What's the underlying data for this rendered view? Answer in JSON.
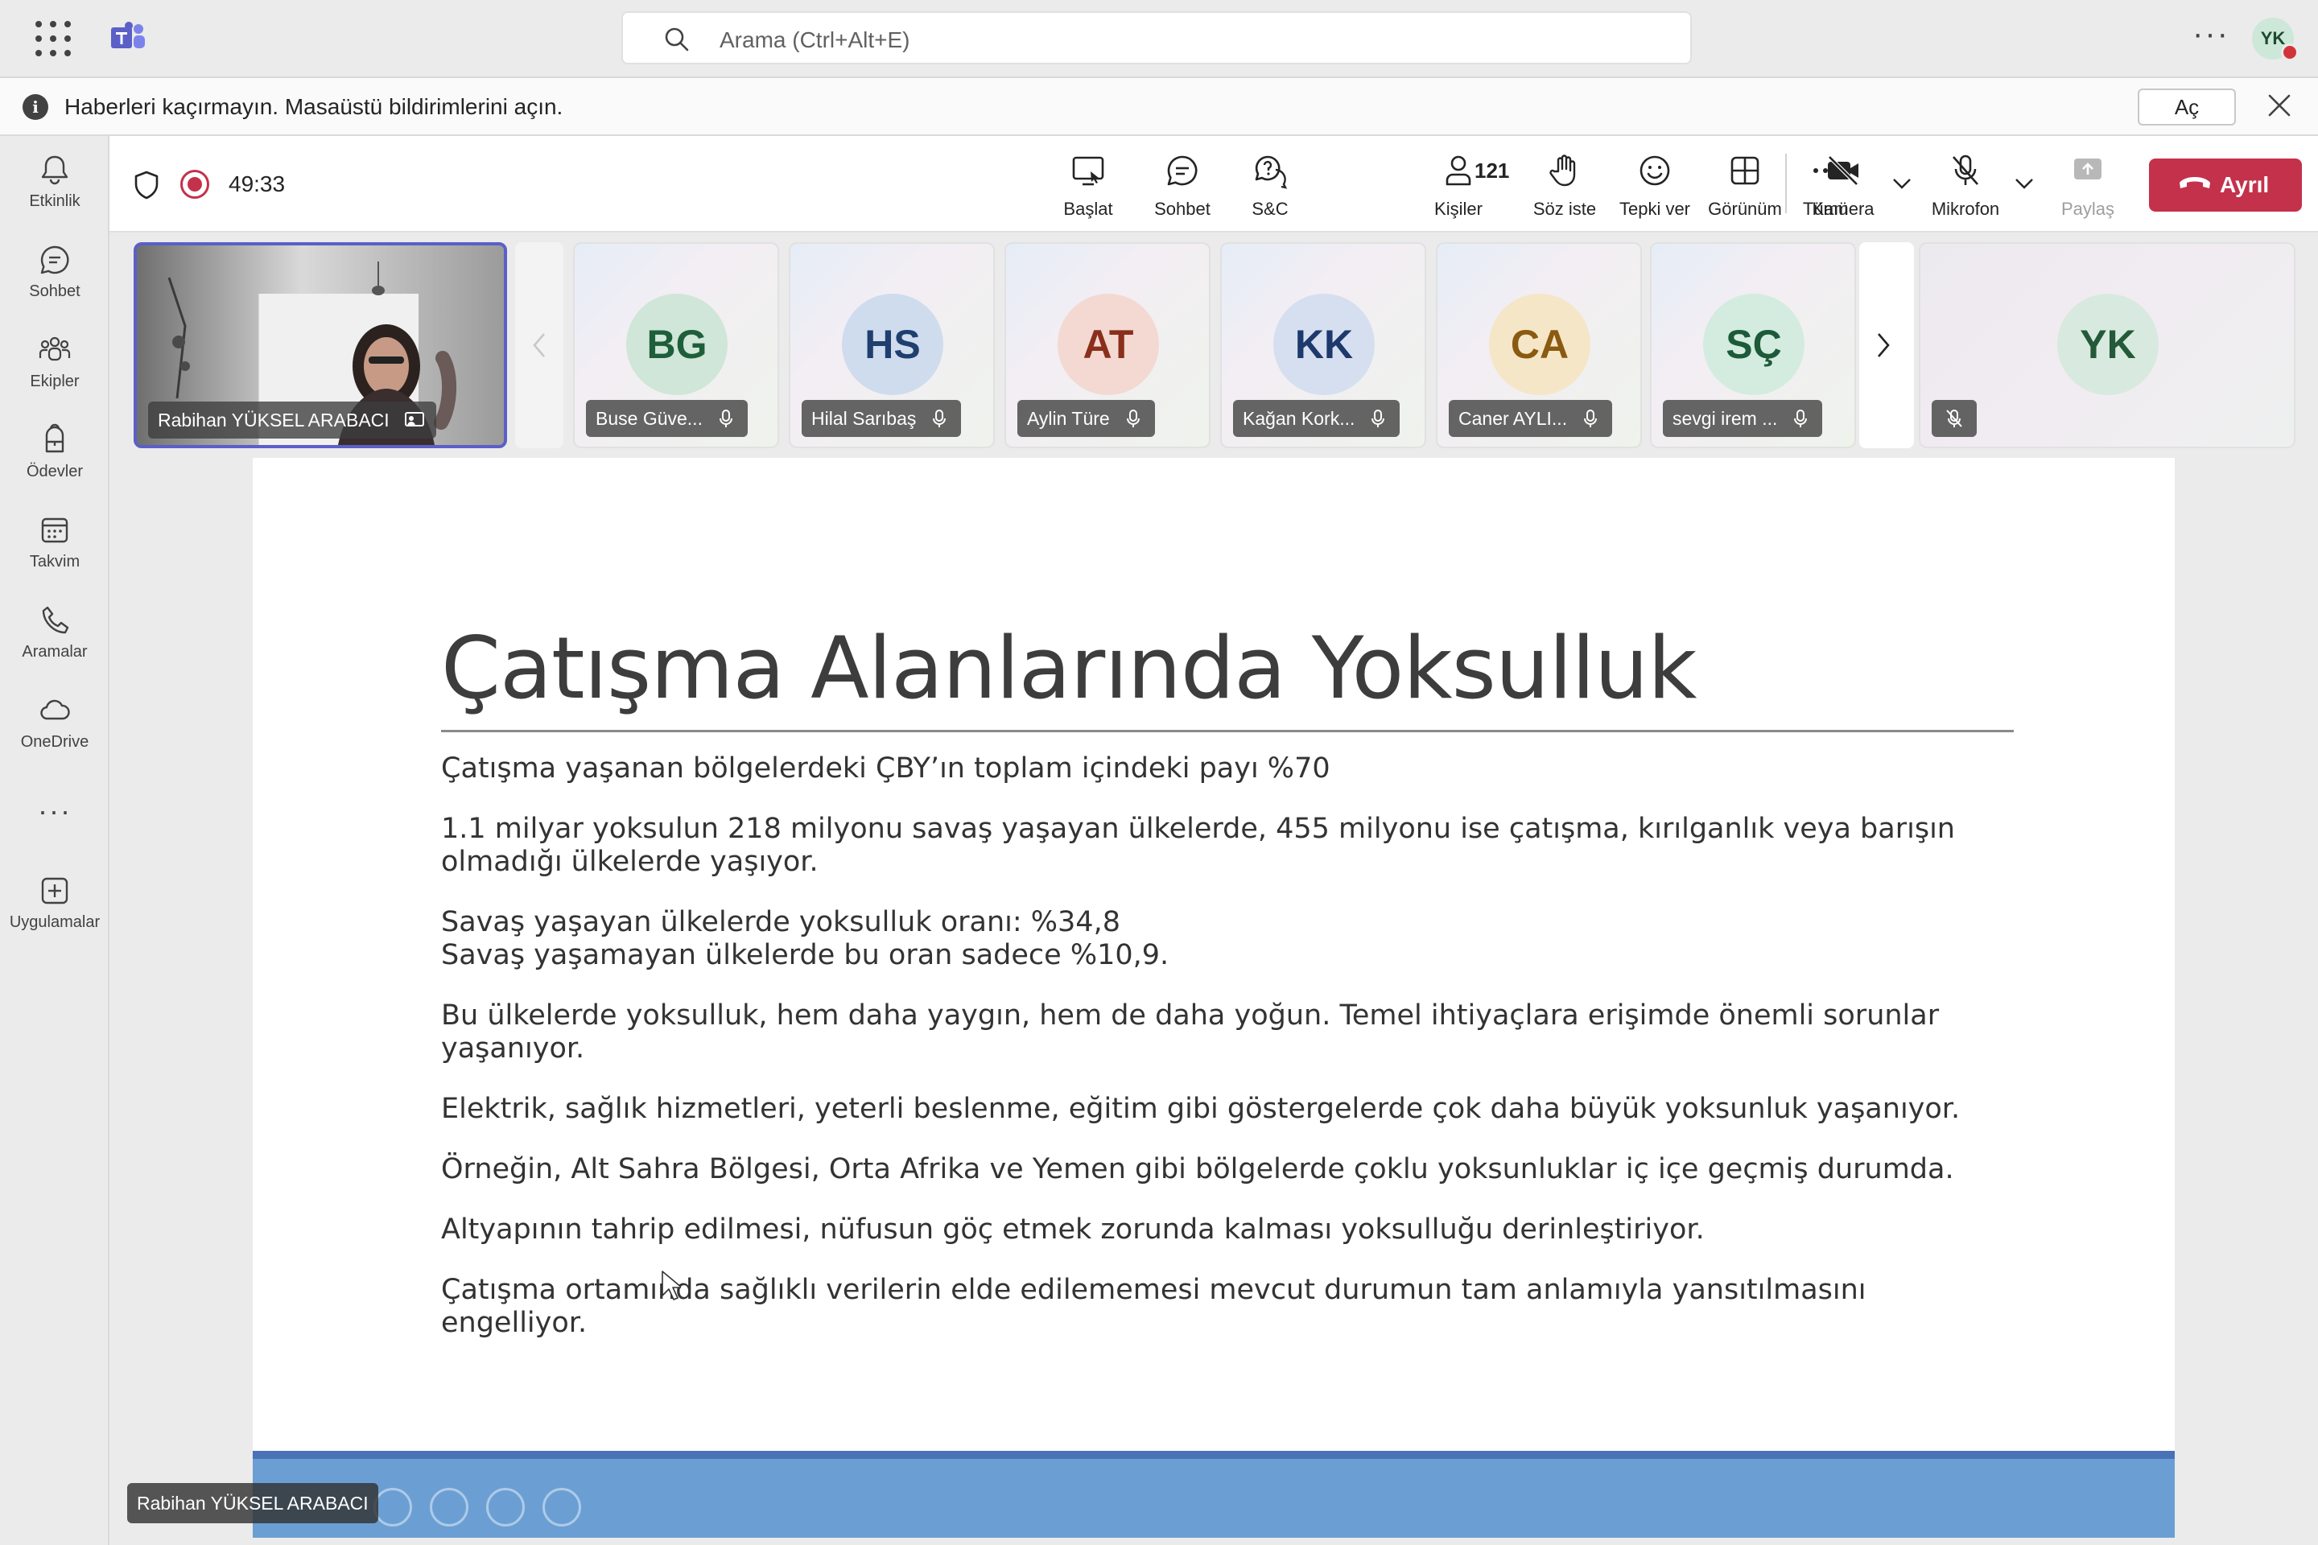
{
  "titlebar": {
    "search_placeholder": "Arama (Ctrl+Alt+E)",
    "user_initials": "YK"
  },
  "notification": {
    "icon_glyph": "i",
    "text": "Haberleri kaçırmayın. Masaüstü bildirimlerini açın.",
    "open_label": "Aç"
  },
  "rail": {
    "items": [
      {
        "label": "Etkinlik",
        "icon": "bell-icon"
      },
      {
        "label": "Sohbet",
        "icon": "chat-icon"
      },
      {
        "label": "Ekipler",
        "icon": "teams-icon"
      },
      {
        "label": "Ödevler",
        "icon": "backpack-icon"
      },
      {
        "label": "Takvim",
        "icon": "calendar-icon"
      },
      {
        "label": "Aramalar",
        "icon": "phone-icon"
      },
      {
        "label": "OneDrive",
        "icon": "cloud-icon"
      }
    ],
    "more": "···",
    "apps_label": "Uygulamalar"
  },
  "meeting": {
    "timer": "49:33",
    "buttons": {
      "start": "Başlat",
      "chat": "Sohbet",
      "qa": "S&C",
      "people": "Kişiler",
      "people_count": "121",
      "raise_hand": "Söz iste",
      "react": "Tepki ver",
      "view": "Görünüm",
      "more": "Tümü",
      "camera": "Kamera",
      "mic": "Mikrofon",
      "share": "Paylaş",
      "leave": "Ayrıl"
    }
  },
  "participants": {
    "presenter": "Rabihan YÜKSEL ARABACI",
    "tiles": [
      {
        "initials": "BG",
        "name": "Buse Güve...",
        "bg": "#cfe6d9",
        "fg": "#1f5e3a"
      },
      {
        "initials": "HS",
        "name": "Hilal Sarıbaş",
        "bg": "#cfdcee",
        "fg": "#1f3f6e"
      },
      {
        "initials": "AT",
        "name": "Aylin Türe",
        "bg": "#f3d9d2",
        "fg": "#8a2f1c"
      },
      {
        "initials": "KK",
        "name": "Kağan Kork...",
        "bg": "#d6dff0",
        "fg": "#1e3a6c"
      },
      {
        "initials": "CA",
        "name": "Caner AYLI...",
        "bg": "#f5e6c8",
        "fg": "#8a5a10"
      },
      {
        "initials": "SÇ",
        "name": "sevgi irem ...",
        "bg": "#d3ecdf",
        "fg": "#1d5a3a"
      }
    ],
    "self_initials": "YK"
  },
  "slide": {
    "title": "Çatışma Alanlarında Yoksulluk",
    "paragraphs": [
      "Çatışma yaşanan bölgelerdeki ÇBY’ın toplam içindeki payı %70",
      "1.1 milyar yoksulun 218 milyonu savaş yaşayan ülkelerde, 455 milyonu ise çatışma, kırılganlık veya barışın olmadığı ülkelerde yaşıyor.",
      "Savaş yaşayan ülkelerde yoksulluk oranı: %34,8",
      "Savaş yaşamayan ülkelerde bu oran sadece %10,9.",
      "Bu ülkelerde yoksulluk, hem daha yaygın, hem de daha yoğun. Temel ihtiyaçlara erişimde önemli sorunlar yaşanıyor.",
      "Elektrik, sağlık hizmetleri, yeterli beslenme, eğitim gibi göstergelerde çok daha büyük yoksunluk yaşanıyor.",
      "Örneğin, Alt Sahra Bölgesi, Orta Afrika ve Yemen gibi bölgelerde çoklu yoksunluklar iç içe geçmiş durumda.",
      "Altyapının tahrip edilmesi, nüfusun göç etmek zorunda kalması yoksulluğu derinleştiriyor.",
      "Çatışma ortamında sağlıklı verilerin elde edilememesi mevcut durumun tam anlamıyla yansıtılmasını engelliyor."
    ]
  },
  "colors": {
    "accent": "#5b5fc7",
    "leave": "#c4314b",
    "slide_footer": "#6b9fd4"
  }
}
